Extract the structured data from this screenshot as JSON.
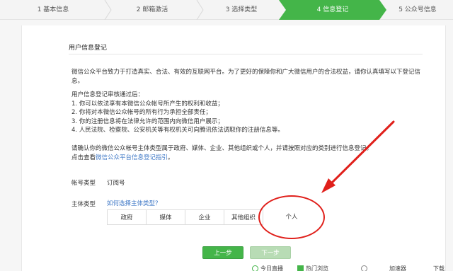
{
  "steps": [
    {
      "label": "1 基本信息"
    },
    {
      "label": "2 邮箱激活"
    },
    {
      "label": "3 选择类型"
    },
    {
      "label": "4 信息登记"
    },
    {
      "label": "5 公众号信息"
    }
  ],
  "section": {
    "title": "用户信息登记"
  },
  "intro": "微信公众平台致力于打造真实、合法、有效的互联网平台。为了更好的保障你和广大微信用户的合法权益，请你认真填写以下登记信息。",
  "review": {
    "heading": "用户信息登记审核通过后：",
    "items": [
      "1. 你可以依法享有本微信公众帐号所产生的权利和收益；",
      "2. 你将对本微信公众帐号的所有行为承担全部责任；",
      "3. 你的注册信息将在法律允许的范围内向微信用户展示；",
      "4. 人民法院、检察院、公安机关等有权机关可向腾讯依法调取你的注册信息等。"
    ]
  },
  "confirm": {
    "text": "请确认你的微信公众帐号主体类型属于政府、媒体、企业、其他组织或个人，并请按照对应的类别进行信息登记。",
    "guide_prefix": "点击查看",
    "guide_link": "微信公众平台信息登记指引",
    "guide_suffix": "。"
  },
  "account": {
    "label": "帐号类型",
    "value": "订阅号"
  },
  "subject": {
    "label": "主体类型",
    "help_link": "如何选择主体类型？",
    "options": [
      "政府",
      "媒体",
      "企业",
      "其他组织",
      "个人"
    ]
  },
  "buttons": {
    "prev": "上一步",
    "next": "下一步"
  },
  "bottom_bar": [
    "今日直播",
    "热门浏览",
    "加速器",
    "下载"
  ],
  "colors": {
    "accent": "#44b549",
    "annotation": "#e0201b",
    "link": "#3f78c6"
  }
}
